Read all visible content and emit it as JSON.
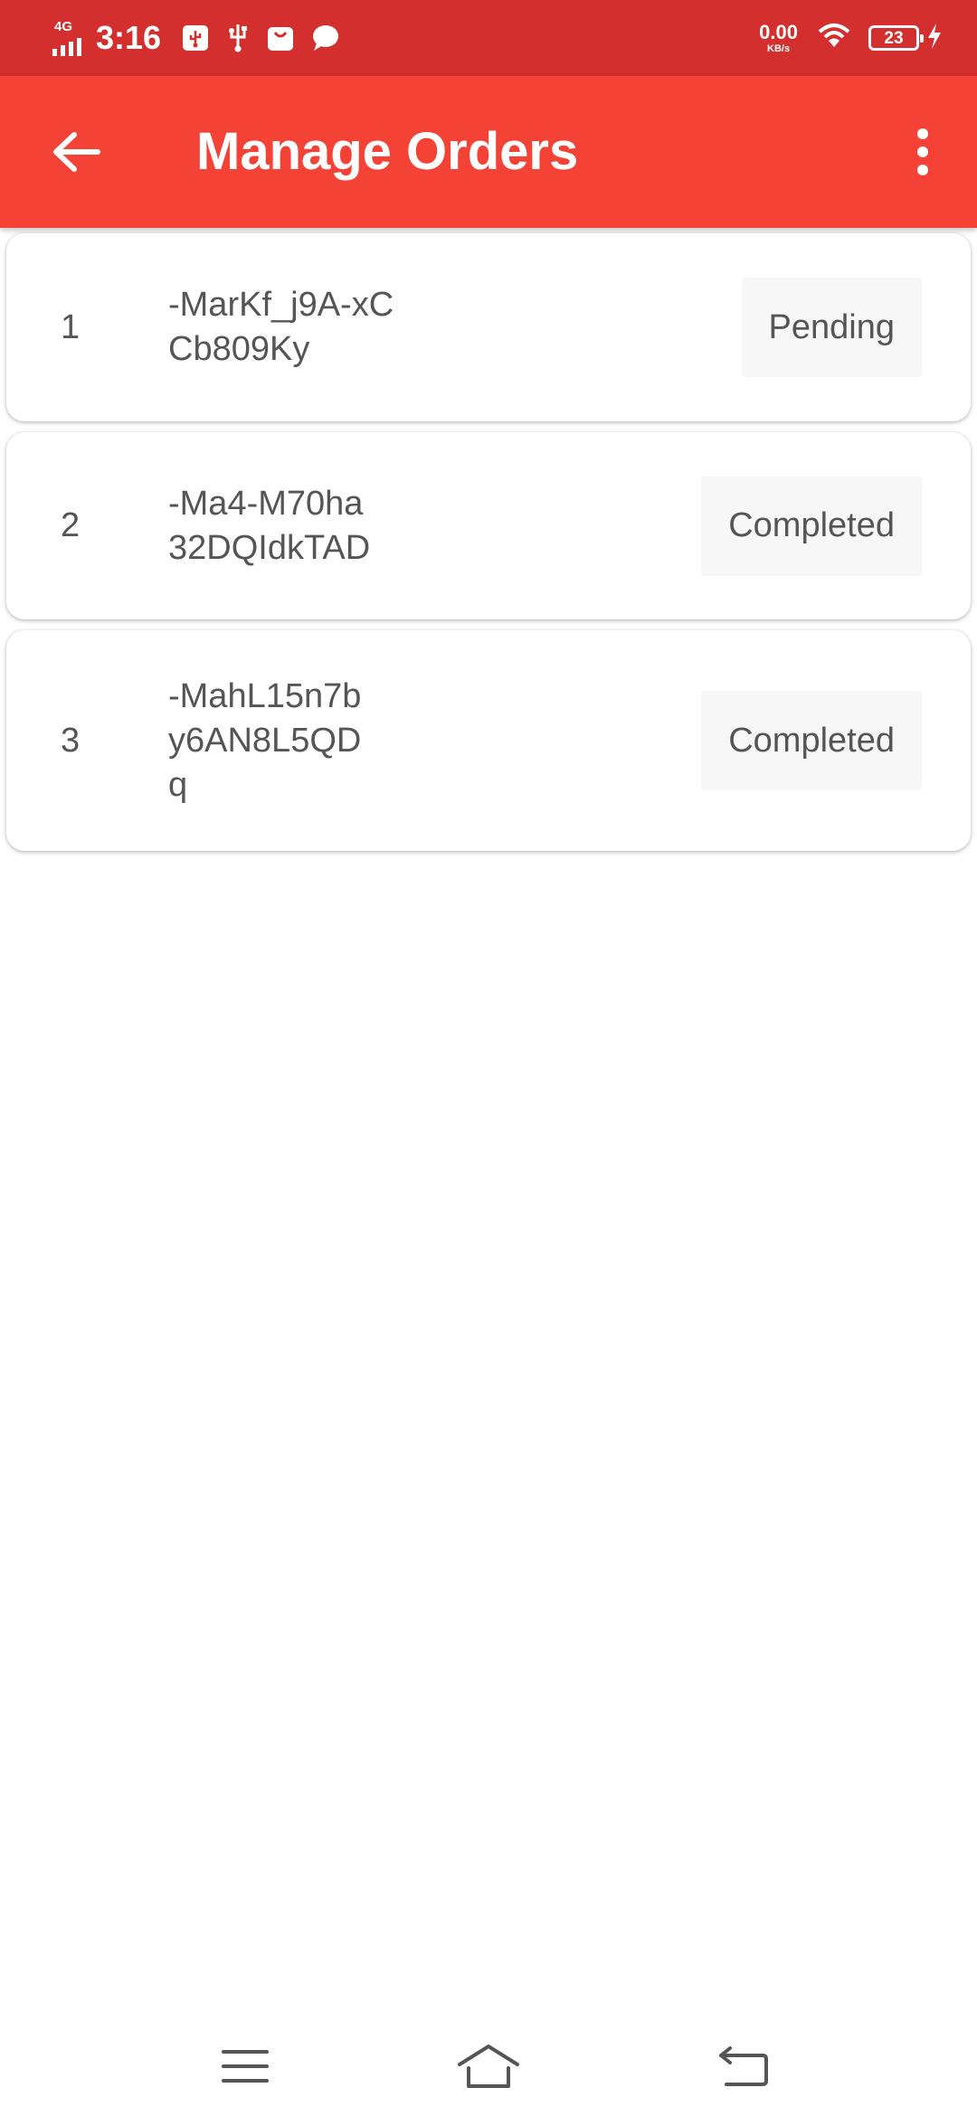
{
  "status_bar": {
    "network_type": "4G",
    "time": "3:16",
    "net_speed_value": "0.00",
    "net_speed_unit": "KB/s",
    "battery_level": "23"
  },
  "app_bar": {
    "title": "Manage Orders",
    "back_icon": "arrow-back-icon",
    "menu_icon": "more-vert-icon",
    "background_color": "#f44336",
    "status_bar_color": "#d32f2f"
  },
  "orders": [
    {
      "index": "1",
      "order_id": "-MarKf_j9A-xC\nCb809Ky",
      "status": "Pending"
    },
    {
      "index": "2",
      "order_id": "-Ma4-M70ha\n32DQIdkTAD",
      "status": "Completed"
    },
    {
      "index": "3",
      "order_id": "-MahL15n7b\ny6AN8L5QD\nq",
      "status": "Completed"
    }
  ],
  "nav_bar": {
    "icons": [
      "menu-icon",
      "home-icon",
      "back-icon"
    ]
  }
}
